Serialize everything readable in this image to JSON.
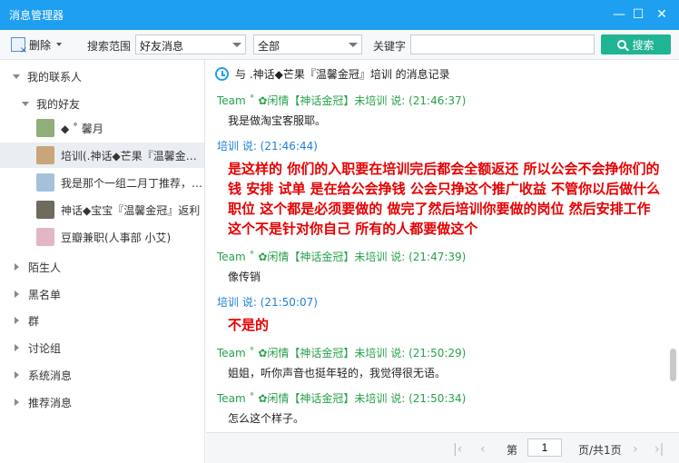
{
  "window": {
    "title": "消息管理器"
  },
  "toolbar": {
    "delete_label": "删除",
    "scope_label": "搜索范围",
    "scope_value": "好友消息",
    "range_value": "全部",
    "keyword_label": "关键字",
    "keyword_value": "",
    "search_label": "搜索"
  },
  "sidebar": {
    "my_contacts": "我的联系人",
    "my_friends": "我的好友",
    "friends": [
      {
        "name": "◆ ˚ 馨月",
        "avatar_color": "#8fae7a"
      },
      {
        "name": "培训(.神话◆芒果『温馨金冠』)",
        "avatar_color": "#c9a57b"
      },
      {
        "name": "我是那个一组二月丁推荐，…",
        "avatar_color": "#a7c0d9"
      },
      {
        "name": "神话◆宝宝『温馨金冠』返利",
        "avatar_color": "#6f6a5e"
      },
      {
        "name": "豆瓣兼职(人事部 小艾)",
        "avatar_color": "#e2b6c6"
      }
    ],
    "groups": [
      "陌生人",
      "黑名单",
      "群",
      "讨论组",
      "系统消息",
      "推荐消息"
    ]
  },
  "chat": {
    "header": "与 .神话◆芒果『温馨金冠』培训 的消息记录",
    "messages": [
      {
        "sender": "Team ˚ ✿闲情【神话金冠】未培训 说: (21:46:37)",
        "color": "green",
        "text": "我是做淘宝客服耶。",
        "big": false
      },
      {
        "sender": "培训 说: (21:46:44)",
        "color": "blue",
        "text": "是这样的  你们的入职要在培训完后都会全额返还 所以公会不会挣你们的钱   安排 试单 是在给公会挣钱  公会只挣这个推广收益  不管你以后做什么职位  这个都是必须要做的  做完了然后培训你要做的岗位 然后安排工作  这个不是针对你自己  所有的人都要做这个",
        "big": true
      },
      {
        "sender": "Team ˚ ✿闲情【神话金冠】未培训 说: (21:47:39)",
        "color": "green",
        "text": "像传销",
        "big": false
      },
      {
        "sender": "培训 说: (21:50:07)",
        "color": "blue",
        "text": "不是的",
        "big": true
      },
      {
        "sender": "Team ˚ ✿闲情【神话金冠】未培训 说: (21:50:29)",
        "color": "green",
        "text": "姐姐，听你声音也挺年轻的，我觉得很无语。",
        "big": false
      },
      {
        "sender": "Team ˚ ✿闲情【神话金冠】未培训 说: (21:50:34)",
        "color": "green",
        "text": "怎么这个样子。",
        "big": false
      }
    ]
  },
  "pagination": {
    "page_prefix": "第",
    "current_page": "1",
    "page_suffix": "页/共1页"
  }
}
